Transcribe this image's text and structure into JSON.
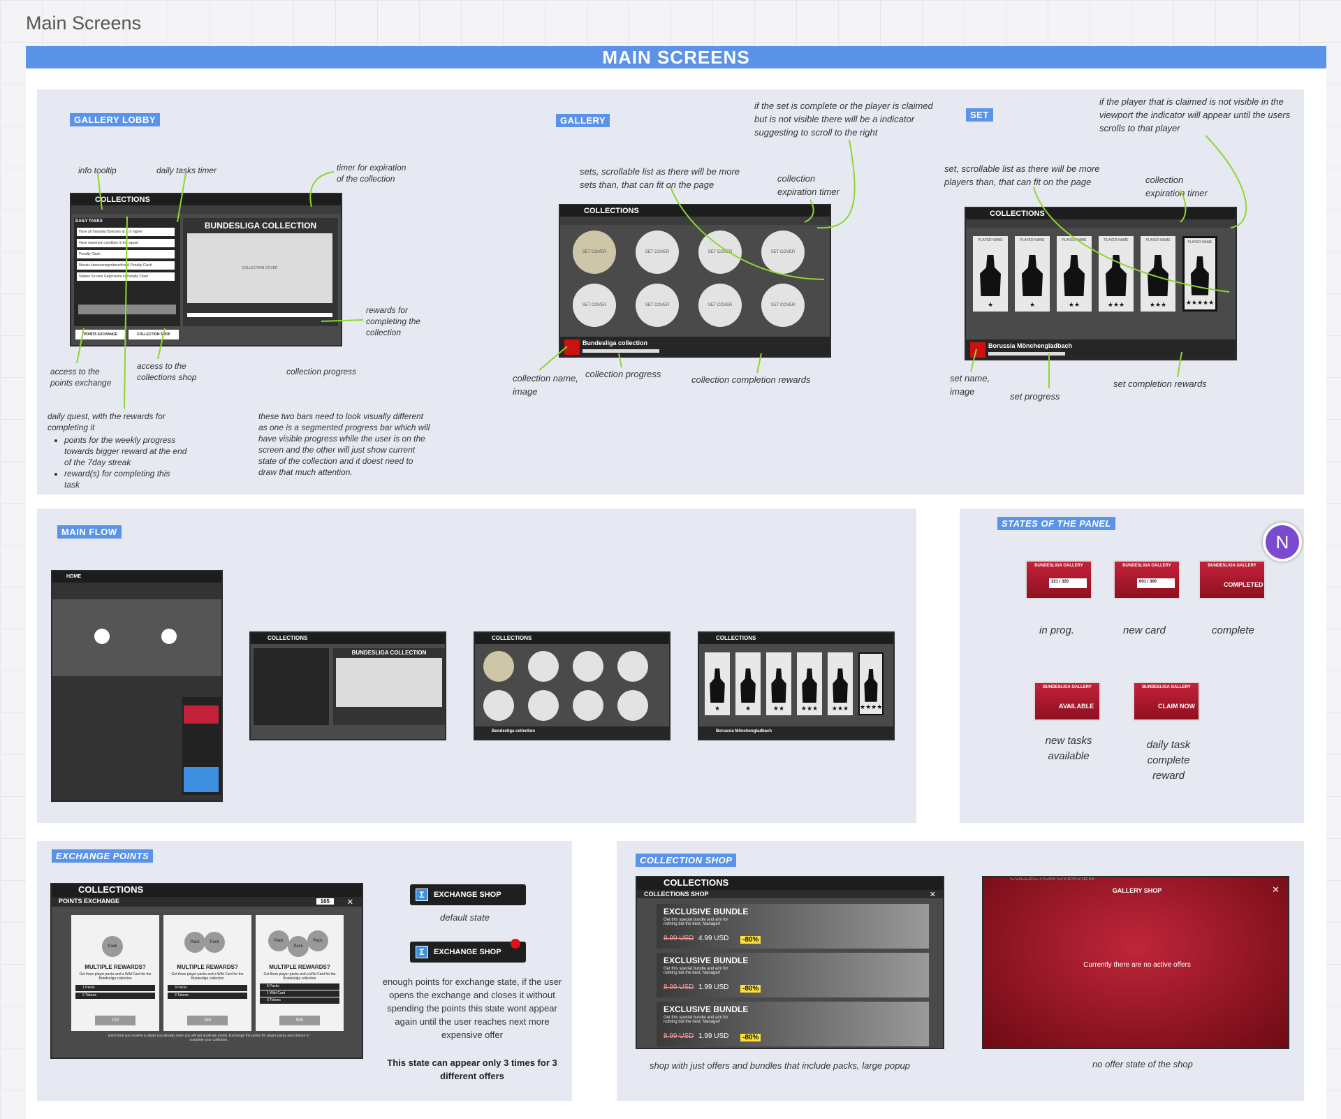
{
  "board_title": "Main Screens",
  "banner": "MAIN SCREENS",
  "avatar_initial": "N",
  "sections": {
    "gallery_lobby": "GALLERY LOBBY",
    "gallery": "GALLERY",
    "set": "SET",
    "main_flow": "MAIN FLOW",
    "states": "STATES OF THE PANEL",
    "exchange": "EXCHANGE POINTS",
    "shop": "COLLECTION SHOP"
  },
  "lobby_notes": {
    "info_tooltip": "info tooltip",
    "daily_timer": "daily tasks timer",
    "expiration": "timer for expiration of the collection",
    "rewards": "rewards for completing the collection",
    "points_exchange": "access to the points exchange",
    "collections_shop": "access to the collections shop",
    "progress": "collection progress",
    "daily_quest": "daily quest, with the rewards for completing it",
    "bullet1": "points for the weekly progress towards bigger reward at the end of the 7day streak",
    "bullet2": "reward(s) for completing this task",
    "two_bars": "these two bars need to look visually different as one is a segmented progress bar which will have visible progress while the user is on the screen and the other will just show current state of the collection and it doest need to draw that much attention."
  },
  "gallery_notes": {
    "scroll_indicator": "if the set is complete or the player is claimed but is not visible there will be a indicator suggesting to scroll to the right",
    "sets_list": "sets, scrollable list as there will be more sets than, that can fit on the page",
    "expiration": "collection expiration timer",
    "name_image": "collection name, image",
    "progress": "collection progress",
    "completion": "collection completion rewards"
  },
  "set_notes": {
    "claimed": "if the player that is claimed is not visible in the viewport the indicator will appear until the users scrolls to that player",
    "players_list": "set, scrollable list as there will be more players than, that can fit on the page",
    "expiration": "collection expiration timer",
    "name_image": "set name, image",
    "progress": "set progress",
    "rewards": "set completion rewards"
  },
  "screens": {
    "collections": "COLLECTIONS",
    "bundesliga": "BUNDESLIGA COLLECTION",
    "collection_cover": "COLLECTION COVER",
    "daily_tasks": "DAILY TASKS",
    "points_exchange_btn": "POINTS EXCHANGE",
    "collection_shop_btn": "COLLECTION SHOP",
    "set_cover": "SET COVER",
    "bundesliga_collection": "Bundesliga collection",
    "borussia": "Borussia Mönchengladbach",
    "player_name": "PLAYER NAME",
    "home": "HOME",
    "tasks": [
      "Have all Tsepalay Bonuses at 2 or higher",
      "Have maximum condition in the squad",
      "Penalty Clash",
      "Mosaic kamenensgenbenefice & Penalty Clash",
      "Starten Se eine Gegenserie in Penalty Clash"
    ]
  },
  "states": [
    {
      "title": "BUNDESLIGA GALLERY",
      "value": "321 / 320",
      "caption": "in prog."
    },
    {
      "title": "BUNDESLIGA GALLERY",
      "value": "001 / 300",
      "caption": "new card"
    },
    {
      "title": "BUNDESLIGA GALLERY",
      "value": "COMPLETED",
      "caption": "complete"
    },
    {
      "title": "BUNDESLIGA GALLERY",
      "value": "AVAILABLE",
      "caption": "new tasks available"
    },
    {
      "title": "BUNDESLIGA GALLERY",
      "value": "CLAIM NOW",
      "caption": "daily task complete reward"
    }
  ],
  "exchange": {
    "collections": "COLLECTIONS",
    "points_exchange": "POINTS EXCHANGE",
    "points": "165",
    "offers": [
      {
        "title": "MULTIPLE REWARDS?",
        "desc": "Get three player packs and a Wild Card for the Bundesliga collection",
        "items": [
          "1 Packs",
          "2 Tokens"
        ],
        "price": "100"
      },
      {
        "title": "MULTIPLE REWARDS?",
        "desc": "Get three player packs and a Wild Card for the Bundesliga collection",
        "items": [
          "3 Packs",
          "3 Tokens"
        ],
        "price": "250"
      },
      {
        "title": "MULTIPLE REWARDS?",
        "desc": "Get three player packs and a Wild Card for the Bundesliga collection",
        "items": [
          "5 Packs",
          "1 Wild Card",
          "3 Tokens"
        ],
        "price": "500"
      }
    ],
    "footer": "Each time you receive a player you already have you will get duplicate points. Exchange the points for player packs and chance to complete your collection.",
    "chip_label": "EXCHANGE SHOP",
    "default_state": "default state",
    "enough_points": "enough points for exchange state, if the user opens the exchange and closes it without spending the points this state wont appear again until the user reaches next more expensive offer",
    "limit": "This state can appear only 3 times for 3 different offers"
  },
  "shop": {
    "collections": "COLLECTIONS",
    "collections_shop": "COLLECTIONS SHOP",
    "bundles": [
      {
        "title": "EXCLUSIVE BUNDLE",
        "desc": "Get this special bundle and aim for nothing but the best, Manager!",
        "old": "8.99 USD",
        "new": "4.99 USD",
        "off": "-80%"
      },
      {
        "title": "EXCLUSIVE BUNDLE",
        "desc": "Get this special bundle and aim for nothing but the best, Manager!",
        "old": "8.99 USD",
        "new": "1.99 USD",
        "off": "-80%"
      },
      {
        "title": "EXCLUSIVE BUNDLE",
        "desc": "Get this special bundle and aim for nothing but the best, Manager!",
        "old": "8.99 USD",
        "new": "1.99 USD",
        "off": "-80%"
      }
    ],
    "caption": "shop with just offers and bundles that include packs, large popup",
    "overview": "COLLECTION OVERVIEW",
    "gallery_shop": "GALLERY SHOP",
    "no_offers": "Currently there are no active offers",
    "no_offer_caption": "no offer state of the shop"
  }
}
